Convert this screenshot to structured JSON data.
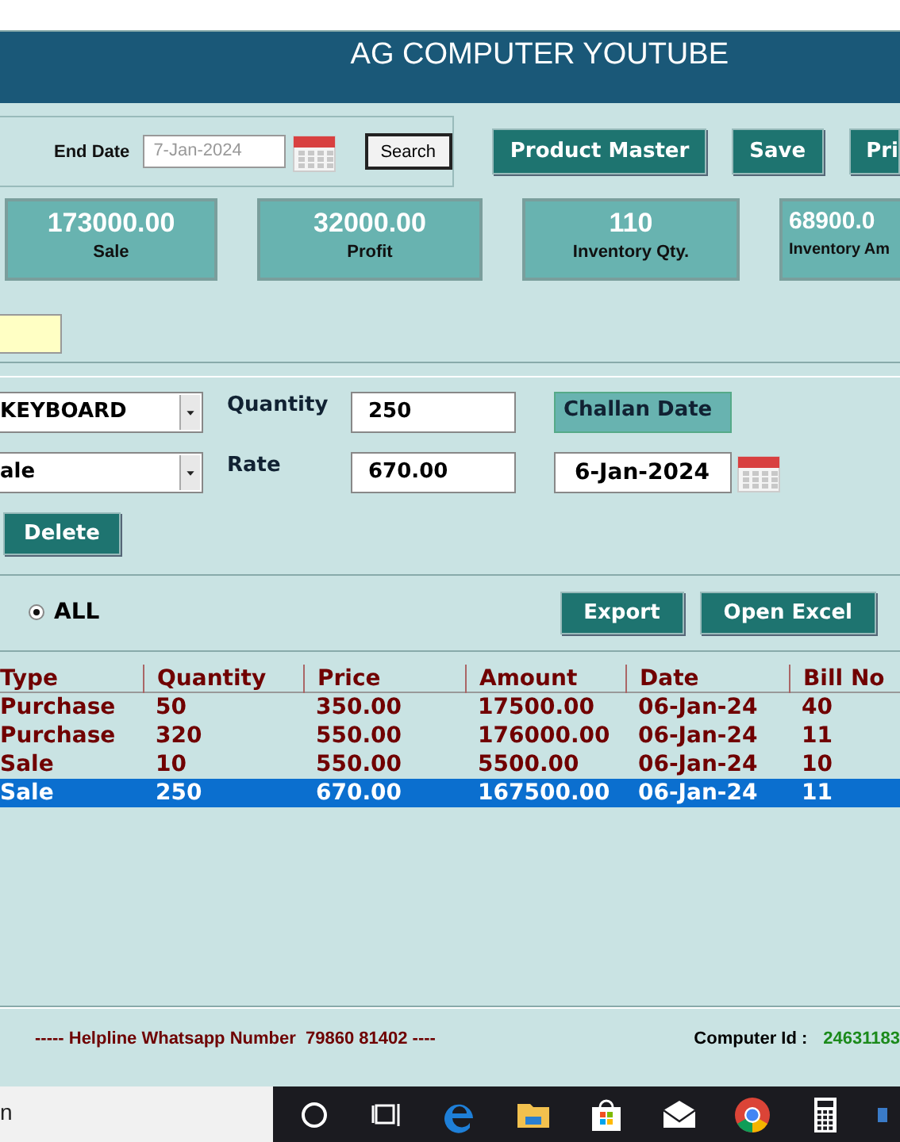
{
  "header": {
    "title": "AG COMPUTER YOUTUBE"
  },
  "filter": {
    "end_date_label": "End Date",
    "end_date": "7-Jan-2024",
    "search_button": "Search"
  },
  "top_buttons": [
    "Product Master",
    "Save",
    "Pri"
  ],
  "stats": [
    {
      "value": "173000.00",
      "label": "Sale"
    },
    {
      "value": "32000.00",
      "label": "Profit"
    },
    {
      "value": "110",
      "label": "Inventory Qty."
    },
    {
      "value": "68900.0",
      "label": "Inventory Am"
    }
  ],
  "form": {
    "product": "KEYBOARD",
    "type": "ale",
    "quantity_label": "Quantity",
    "quantity": "250",
    "rate_label": "Rate",
    "rate": "670.00",
    "challan_date_label": "Challan Date",
    "challan_date": "6-Jan-2024",
    "delete_button": "Delete"
  },
  "filter_options": [
    {
      "label": "ALL",
      "selected": true
    }
  ],
  "action_buttons": [
    "Export",
    "Open Excel"
  ],
  "table": {
    "columns": [
      "Type",
      "Quantity",
      "Price",
      "Amount",
      "Date",
      "Bill No"
    ],
    "rows": [
      {
        "cells": [
          "Purchase",
          "50",
          "350.00",
          "17500.00",
          "06-Jan-24",
          "40"
        ],
        "selected": false
      },
      {
        "cells": [
          "Purchase",
          "320",
          "550.00",
          "176000.00",
          "06-Jan-24",
          "11"
        ],
        "selected": false
      },
      {
        "cells": [
          "Sale",
          "10",
          "550.00",
          "5500.00",
          "06-Jan-24",
          "10"
        ],
        "selected": false
      },
      {
        "cells": [
          "Sale",
          "250",
          "670.00",
          "167500.00",
          "06-Jan-24",
          "11"
        ],
        "selected": true
      }
    ]
  },
  "footer": {
    "helpline": "----- Helpline Whatsapp Number  79860 81402 ----",
    "computer_id_label": "Computer Id :",
    "computer_id": "24631183"
  },
  "taskbar": {
    "search_text": "n"
  }
}
